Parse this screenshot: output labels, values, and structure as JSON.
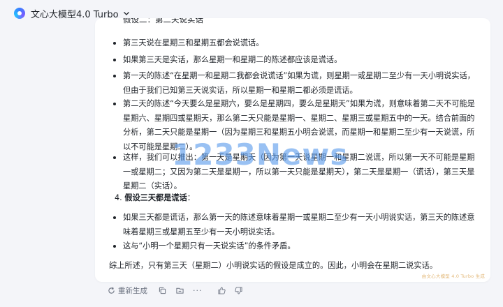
{
  "header": {
    "model_name": "文心大模型4.0 Turbo"
  },
  "message": {
    "cut_line": "假设二：第二天说实话",
    "bullets_a": [
      "第三天说在星期三和星期五都会说谎话。",
      "如果第三天是实话，那么星期一和星期二的陈述都应该是谎话。",
      "第一天的陈述“在星期一和星期二我都会说谎话”如果为谎，则星期一或星期二至少有一天小明说实话，但由于我们已知第三天说实话，所以星期一和星期二都必须是谎话。",
      "第二天的陈述“今天要么是星期六，要么是星期四，要么是星期天”如果为谎，则意味着第二天不可能是星期六、星期四或星期天，那么第二天只能是星期一、星期二、星期三或星期五中的一天。结合前面的分析，第二天只能是星期一（因为星期三和星期五小明会说谎，而星期一和星期二至少有一天说谎，所以不可能是星期二）。",
      "这样，我们可以推出：第一天是星期天（因为第一天说星期一和星期二说谎，所以第一天不可能是星期一或星期二；又因为第二天是星期一，所以第一天只能是星期天），第二天是星期一（谎话），第三天是星期二（实话）。"
    ],
    "case4_number": "4.",
    "case4_heading": "假设三天都是谎话",
    "case4_colon": "：",
    "bullets_b": [
      "如果三天都是谎话，那么第一天的陈述意味着星期一或星期二至少有一天小明说实话，第三天的陈述意味着星期三或星期五至少有一天小明说实话。",
      "这与“小明一个星期只有一天说实话”的条件矛盾。"
    ],
    "summary": "综上所述，只有第三天（星期二）小明说实话的假设是成立的。因此，小明会在星期二说实话。",
    "ai_mark": "由文心大模型 4.0 Turbo 生成"
  },
  "toolbar": {
    "regenerate_label": "重新生成",
    "more_label": "···"
  },
  "watermark": {
    "text": "1233News"
  },
  "icons": {
    "model_dropdown": "chevron-down-icon",
    "regenerate": "refresh-icon",
    "copy": "copy-icon",
    "save": "folder-icon",
    "more": "ellipsis-icon",
    "like": "thumbs-up-icon",
    "dislike": "thumbs-down-icon"
  }
}
